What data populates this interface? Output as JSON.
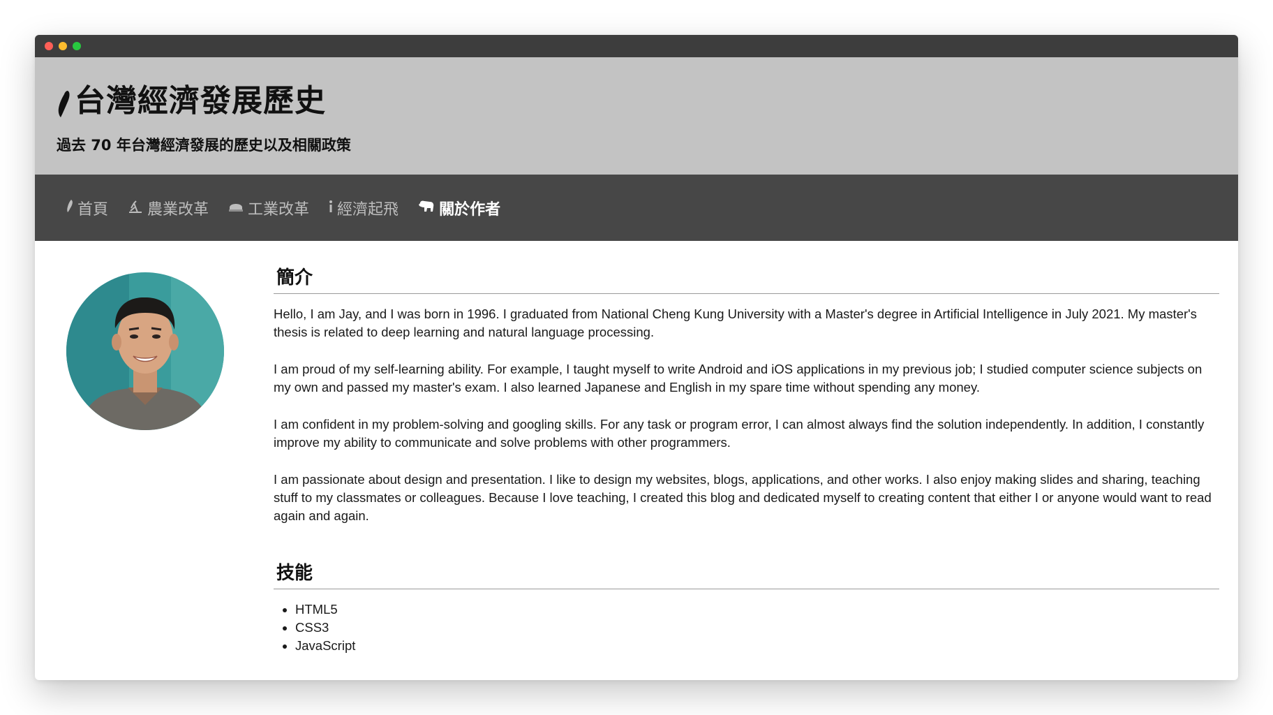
{
  "window": {
    "controls": [
      "close",
      "minimize",
      "maximize"
    ]
  },
  "header": {
    "title": "台灣經濟發展歷史",
    "subtitle": "過去 70 年台灣經濟發展的歷史以及相關政策",
    "logo_icon": "taiwan-island-icon"
  },
  "nav": {
    "items": [
      {
        "label": "首頁",
        "icon": "taiwan-island-icon",
        "active": false
      },
      {
        "label": "農業改革",
        "icon": "farmer-icon",
        "active": false
      },
      {
        "label": "工業改革",
        "icon": "factory-icon",
        "active": false
      },
      {
        "label": "經濟起飛",
        "icon": "info-icon",
        "active": false
      },
      {
        "label": "關於作者",
        "icon": "bear-icon",
        "active": true
      }
    ]
  },
  "profile": {
    "avatar": "author-photo"
  },
  "intro": {
    "heading": "簡介",
    "paragraphs": [
      "Hello, I am Jay, and I was born in 1996. I graduated from National Cheng Kung University with a Master's degree in Artificial Intelligence in July 2021. My master's thesis is related to deep learning and natural language processing.",
      "I am proud of my self-learning ability. For example, I taught myself to write Android and iOS applications in my previous job; I studied computer science subjects on my own and passed my master's exam. I also learned Japanese and English in my spare time without spending any money.",
      "I am confident in my problem-solving and googling skills. For any task or program error, I can almost always find the solution independently. In addition, I constantly improve my ability to communicate and solve problems with other programmers.",
      "I am passionate about design and presentation. I like to design my websites, blogs, applications, and other works. I also enjoy making slides and sharing, teaching stuff to my classmates or colleagues. Because I love teaching, I created this blog and dedicated myself to creating content that either I or anyone would want to read again and again."
    ]
  },
  "skills": {
    "heading": "技能",
    "items": [
      "HTML5",
      "CSS3",
      "JavaScript"
    ]
  },
  "colors": {
    "titlebar": "#3d3d3d",
    "header_bg": "#c3c3c3",
    "nav_bg": "#474747",
    "nav_text": "#bdbdbd",
    "nav_active": "#ffffff",
    "avatar_bg": "#3a9c9c"
  }
}
